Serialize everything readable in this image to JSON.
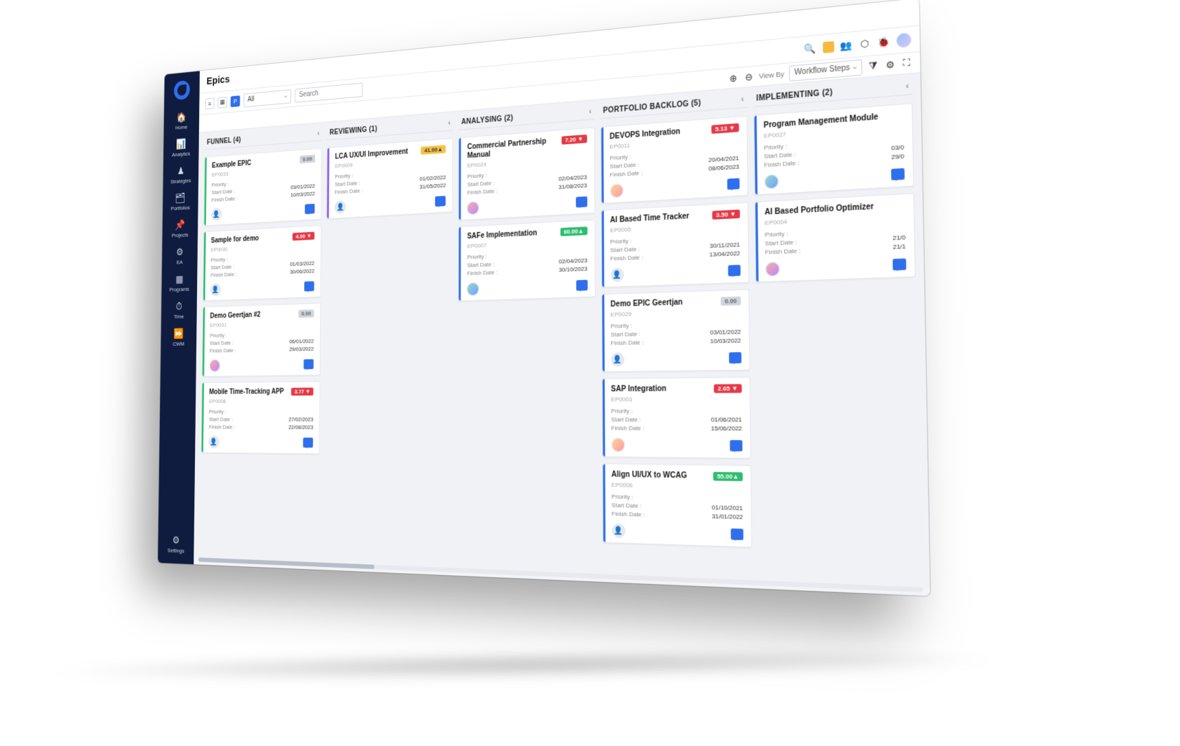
{
  "page_title": "Epics",
  "sidebar": {
    "items": [
      {
        "icon": "🏠",
        "label": "Home"
      },
      {
        "icon": "📊",
        "label": "Analytics"
      },
      {
        "icon": "♟",
        "label": "Strategies"
      },
      {
        "icon": "🗂",
        "label": "Portfolios"
      },
      {
        "icon": "📌",
        "label": "Projects"
      },
      {
        "icon": "⚙",
        "label": "EA"
      },
      {
        "icon": "▦",
        "label": "Programs"
      },
      {
        "icon": "⏱",
        "label": "Time"
      },
      {
        "icon": "⏩",
        "label": "CWM"
      }
    ],
    "settings_label": "Settings",
    "settings_icon": "⚙"
  },
  "toolbar": {
    "filter_select": "All",
    "search_placeholder": "Search",
    "viewby_label": "View By",
    "viewby_value": "Workflow Steps"
  },
  "columns": [
    {
      "name": "FUNNEL",
      "count": 4,
      "cards": [
        {
          "title": "Example EPIC",
          "id": "EP0033",
          "score": "0.00",
          "score_cls": "sc-grey",
          "stripe": "#2dbd6e",
          "priority": "",
          "start": "03/01/2022",
          "finish": "10/03/2022",
          "ava": ""
        },
        {
          "title": "Sample for demo",
          "id": "EP0030",
          "score": "4.00 ▼",
          "score_cls": "sc-red",
          "stripe": "#2dbd6e",
          "priority": "",
          "start": "01/03/2022",
          "finish": "30/06/2022",
          "ava": ""
        },
        {
          "title": "Demo Geertjan #2",
          "id": "EP0031",
          "score": "0.00",
          "score_cls": "sc-grey",
          "stripe": "#2dbd6e",
          "priority": "",
          "start": "06/01/2022",
          "finish": "29/03/2022",
          "ava": "p1"
        },
        {
          "title": "Mobile Time-Tracking APP",
          "id": "EP0008",
          "score": "3.77 ▼",
          "score_cls": "sc-red",
          "stripe": "#2dbd6e",
          "priority": "",
          "start": "27/02/2023",
          "finish": "22/08/2023",
          "ava": ""
        }
      ]
    },
    {
      "name": "REVIEWING",
      "count": 1,
      "cards": [
        {
          "title": "LCA UX/UI Improvement",
          "id": "EP0009",
          "score": "41.00▲",
          "score_cls": "sc-yellow",
          "stripe": "#8b5cf6",
          "priority": "",
          "start": "01/02/2022",
          "finish": "31/05/2022",
          "ava": ""
        }
      ]
    },
    {
      "name": "ANALYSING",
      "count": 2,
      "cards": [
        {
          "title": "Commercial Partnership Manual",
          "id": "EP0024",
          "score": "7.20 ▼",
          "score_cls": "sc-red",
          "stripe": "#2f6feb",
          "priority": "",
          "start": "02/04/2023",
          "finish": "31/08/2023",
          "ava": "p1"
        },
        {
          "title": "SAFe Implementation",
          "id": "EP0007",
          "score": "60.00▲",
          "score_cls": "sc-green",
          "stripe": "#2f6feb",
          "priority": "",
          "start": "02/04/2023",
          "finish": "30/10/2023",
          "ava": "p2"
        }
      ]
    },
    {
      "name": "PORTFOLIO BACKLOG",
      "count": 5,
      "cards": [
        {
          "title": "DEVOPS Integration",
          "id": "EP0011",
          "score": "5.13 ▼",
          "score_cls": "sc-red",
          "stripe": "#2f6feb",
          "priority": "",
          "start": "20/04/2021",
          "finish": "08/06/2023",
          "ava": "p3"
        },
        {
          "title": "AI Based Time Tracker",
          "id": "EP0005",
          "score": "3.50 ▼",
          "score_cls": "sc-red",
          "stripe": "#2f6feb",
          "priority": "",
          "start": "30/11/2021",
          "finish": "13/04/2022",
          "ava": ""
        },
        {
          "title": "Demo EPIC Geertjan",
          "id": "EP0029",
          "score": "0.00",
          "score_cls": "sc-grey",
          "stripe": "#2f6feb",
          "priority": "",
          "start": "03/01/2022",
          "finish": "10/03/2022",
          "ava": ""
        },
        {
          "title": "SAP Integration",
          "id": "EP0003",
          "score": "2.65 ▼",
          "score_cls": "sc-red",
          "stripe": "#2f6feb",
          "priority": "",
          "start": "01/06/2021",
          "finish": "15/06/2022",
          "ava": "p3"
        },
        {
          "title": "Align UI/UX to WCAG",
          "id": "EP0006",
          "score": "55.00▲",
          "score_cls": "sc-green",
          "stripe": "#2f6feb",
          "priority": "",
          "start": "01/10/2021",
          "finish": "31/01/2022",
          "ava": ""
        }
      ]
    },
    {
      "name": "IMPLEMENTING",
      "count": 2,
      "cards": [
        {
          "title": "Program Management Module",
          "id": "EP0027",
          "score": "",
          "score_cls": "sc-red",
          "stripe": "#2f6feb",
          "priority": "",
          "start": "03/0",
          "finish": "29/0",
          "ava": "p2"
        },
        {
          "title": "AI Based Portfolio Optimizer",
          "id": "EP0004",
          "score": "",
          "score_cls": "sc-yellow",
          "stripe": "#2f6feb",
          "priority": "",
          "start": "21/0",
          "finish": "21/1",
          "ava": "p1"
        }
      ]
    }
  ],
  "labels": {
    "priority": "Priority :",
    "start": "Start Date :",
    "finish": "Finish Date :"
  }
}
